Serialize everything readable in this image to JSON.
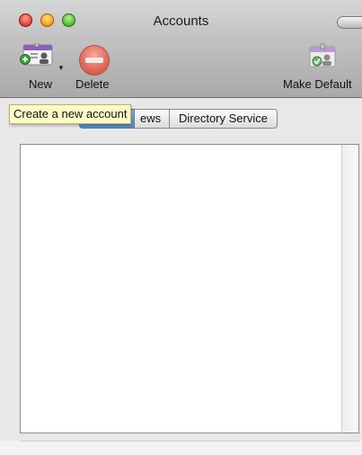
{
  "window": {
    "title": "Accounts"
  },
  "toolbar": {
    "new_label": "New",
    "delete_label": "Delete",
    "make_default_label": "Make Default"
  },
  "tabs": [
    {
      "label": "",
      "selected": true
    },
    {
      "label": "ews",
      "selected": false
    },
    {
      "label": "Directory Service",
      "selected": false
    }
  ],
  "tooltip": {
    "text": "Create a new account"
  },
  "colors": {
    "tab_selected": "#5b8cc4",
    "tooltip_bg": "#fffbc4"
  }
}
